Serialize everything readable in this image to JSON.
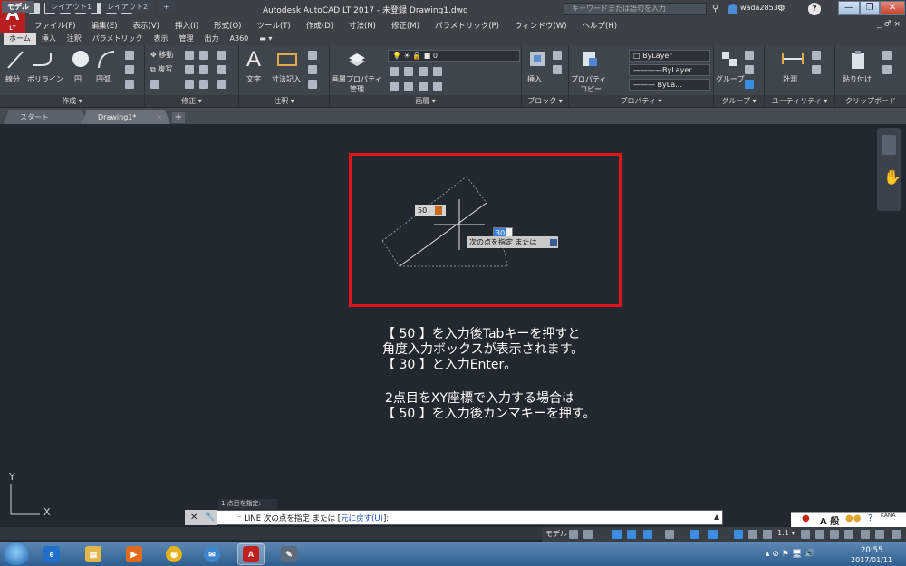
{
  "window": {
    "title": "Autodesk AutoCAD LT 2017 - 未登録   Drawing1.dwg",
    "logo_text": "A",
    "logo_sub": "LT",
    "search_placeholder": "キーワードまたは語句を入力",
    "user_name": "wada28530",
    "doc_controls": "_ ♂ ×"
  },
  "menu": [
    "ファイル(F)",
    "編集(E)",
    "表示(V)",
    "挿入(I)",
    "形式(O)",
    "ツール(T)",
    "作成(D)",
    "寸法(N)",
    "修正(M)",
    "パラメトリック(P)",
    "ウィンドウ(W)",
    "ヘルプ(H)"
  ],
  "ribbon_tabs": [
    "ホーム",
    "挿入",
    "注釈",
    "パラメトリック",
    "表示",
    "管理",
    "出力",
    "A360"
  ],
  "ribbon": {
    "draw": {
      "title": "作成 ▾",
      "line": "線分",
      "polyline": "ポリライン",
      "circle": "円",
      "arc": "円弧"
    },
    "modify": {
      "title": "修正 ▾",
      "move": "移動",
      "copy": "複写"
    },
    "annotation": {
      "title": "注釈 ▾",
      "text": "文字",
      "dimension": "寸法記入"
    },
    "layers": {
      "title": "画層 ▾",
      "layer_props_1": "画層プロパティ",
      "layer_props_2": "管理",
      "layer_value": "0"
    },
    "block": {
      "title": "ブロック ▾",
      "insert": "挿入"
    },
    "properties": {
      "title": "プロパティ ▾",
      "match_1": "プロパティ",
      "match_2": "コピー",
      "color": "ByLayer",
      "linetype": "————ByLayer",
      "lineweight": "——— ByLa…"
    },
    "groups": {
      "title": "グループ ▾",
      "group": "グループ"
    },
    "utilities": {
      "title": "ユーティリティ ▾",
      "measure": "計測"
    },
    "clipboard": {
      "title": "クリップボード",
      "paste": "貼り付け"
    }
  },
  "file_tabs": {
    "start": "スタート",
    "drawing": "Drawing1*",
    "drawing_close": "×",
    "add": "+"
  },
  "canvas": {
    "dyn_length": "50",
    "dyn_angle": "30",
    "prompt_tip": "次の点を指定 または"
  },
  "instructions": [
    "【 50 】を入力後Tabキーを押すと",
    "角度入力ボックスが表示されます。",
    "【 30 】と入力Enter。",
    "",
    "2点目をXY座標で入力する場合は",
    "【 50 】を入力後カンマキーを押す。"
  ],
  "ucs": {
    "x": "X",
    "y": "Y"
  },
  "command": {
    "history": "1 点目を指定:",
    "prefix": "⁻ LINE 次の点を指定 または [",
    "option": "元に戻す(U)",
    "suffix": "]:"
  },
  "layout_tabs": [
    "モデル",
    "レイアウト1",
    "レイアウト2",
    "+"
  ],
  "status": {
    "model": "モデル",
    "scale": "1:1 ▾"
  },
  "tray": {
    "ime": "A 般",
    "kana": "KANA"
  },
  "clock": {
    "time": "20:55",
    "date": "2017/01/11"
  },
  "colors": {
    "accent_red": "#e2141b",
    "canvas": "#212830",
    "ribbon": "#3f454d"
  }
}
